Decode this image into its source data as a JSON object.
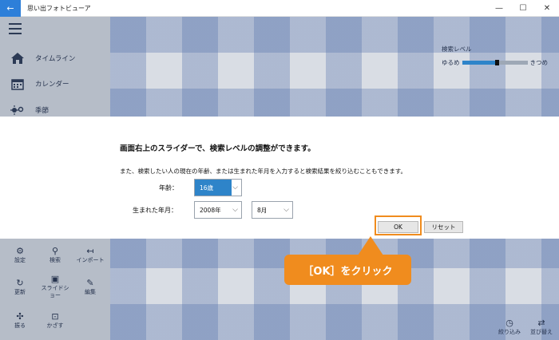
{
  "window": {
    "title": "思い出フォトビューア",
    "back_icon": "←",
    "minimize_icon": "—",
    "maximize_icon": "☐",
    "close_icon": "✕"
  },
  "sidebar": {
    "items": [
      {
        "label": "タイムライン",
        "icon": "home-icon"
      },
      {
        "label": "カレンダー",
        "icon": "calendar-icon"
      },
      {
        "label": "季節",
        "icon": "season-icon"
      }
    ]
  },
  "search_level": {
    "title": "検索レベル",
    "left_label": "ゆるめ",
    "right_label": "きつめ",
    "value": 0.53,
    "accent_color": "#2e84c9"
  },
  "dialog": {
    "title": "画面右上のスライダーで、検索レベルの調整ができます。",
    "description": "また、検索したい人の現在の年齢、または生まれた年月を入力すると検索結果を絞り込むこともできます。",
    "age_label": "年齢：",
    "age_value": "16歳",
    "birth_label": "生まれた年月：",
    "year_value": "2008年",
    "month_value": "8月",
    "caret": "⌵",
    "ok_label": "OK",
    "reset_label": "リセット"
  },
  "commands": [
    {
      "label": "設定",
      "icon": "gear-icon",
      "glyph": "⚙"
    },
    {
      "label": "検索",
      "icon": "search-icon",
      "glyph": "⚲"
    },
    {
      "label": "インポート",
      "icon": "import-icon",
      "glyph": "↤"
    },
    {
      "label": "更新",
      "icon": "refresh-icon",
      "glyph": "↻"
    },
    {
      "label": "スライドショー",
      "icon": "slideshow-icon",
      "glyph": "▣"
    },
    {
      "label": "編集",
      "icon": "edit-icon",
      "glyph": "✎"
    },
    {
      "label": "振る",
      "icon": "shake-icon",
      "glyph": "✣"
    },
    {
      "label": "かざす",
      "icon": "hold-icon",
      "glyph": "⊡"
    }
  ],
  "bottom_right": [
    {
      "label": "絞り込み",
      "icon": "filter-clock-icon",
      "glyph": "◷"
    },
    {
      "label": "並び替え",
      "icon": "sort-icon",
      "glyph": "⇄"
    }
  ],
  "callout": {
    "text": "［OK］をクリック",
    "color": "#f08c1e"
  }
}
